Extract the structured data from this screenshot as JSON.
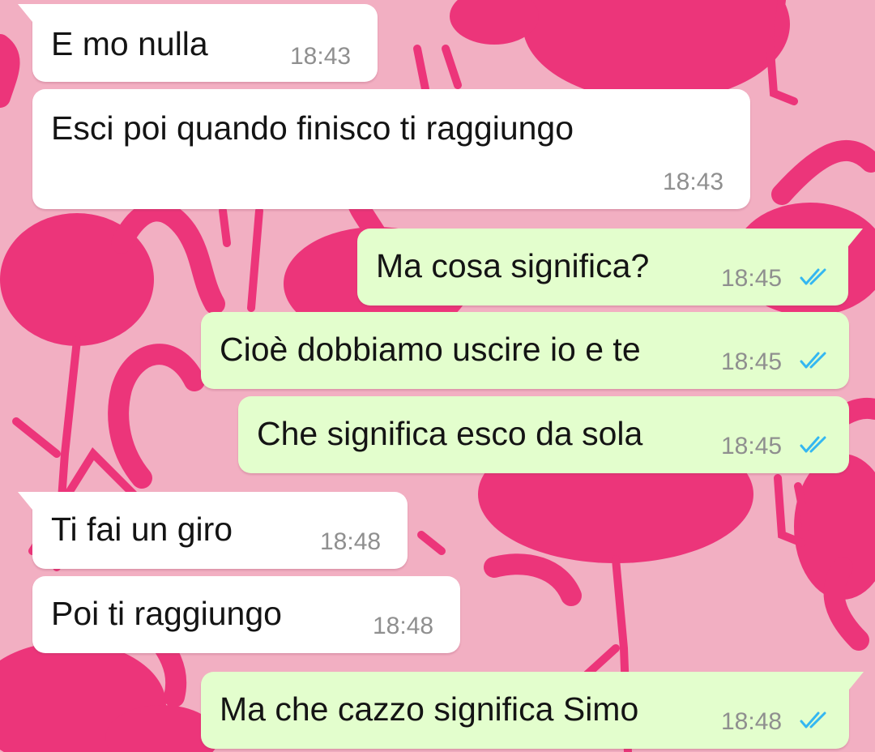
{
  "theme": {
    "wallpaper_pink": "#f2afc2",
    "flamingo_pink": "#ec357a",
    "incoming_bubble": "#ffffff",
    "outgoing_bubble": "#e3fecd",
    "tick_blue": "#34b7f1"
  },
  "messages": [
    {
      "direction": "incoming",
      "text": "E mo nulla",
      "time": "18:43"
    },
    {
      "direction": "incoming",
      "text": "Esci poi quando finisco ti raggiungo",
      "time": "18:43"
    },
    {
      "direction": "outgoing",
      "text": "Ma cosa significa?",
      "time": "18:45",
      "status": "read"
    },
    {
      "direction": "outgoing",
      "text": "Cioè dobbiamo uscire io e te",
      "time": "18:45",
      "status": "read"
    },
    {
      "direction": "outgoing",
      "text": "Che significa esco da sola",
      "time": "18:45",
      "status": "read"
    },
    {
      "direction": "incoming",
      "text": "Ti fai un giro",
      "time": "18:48"
    },
    {
      "direction": "incoming",
      "text": "Poi ti raggiungo",
      "time": "18:48"
    },
    {
      "direction": "outgoing",
      "text": "Ma che cazzo significa Simo",
      "time": "18:48",
      "status": "read"
    }
  ]
}
